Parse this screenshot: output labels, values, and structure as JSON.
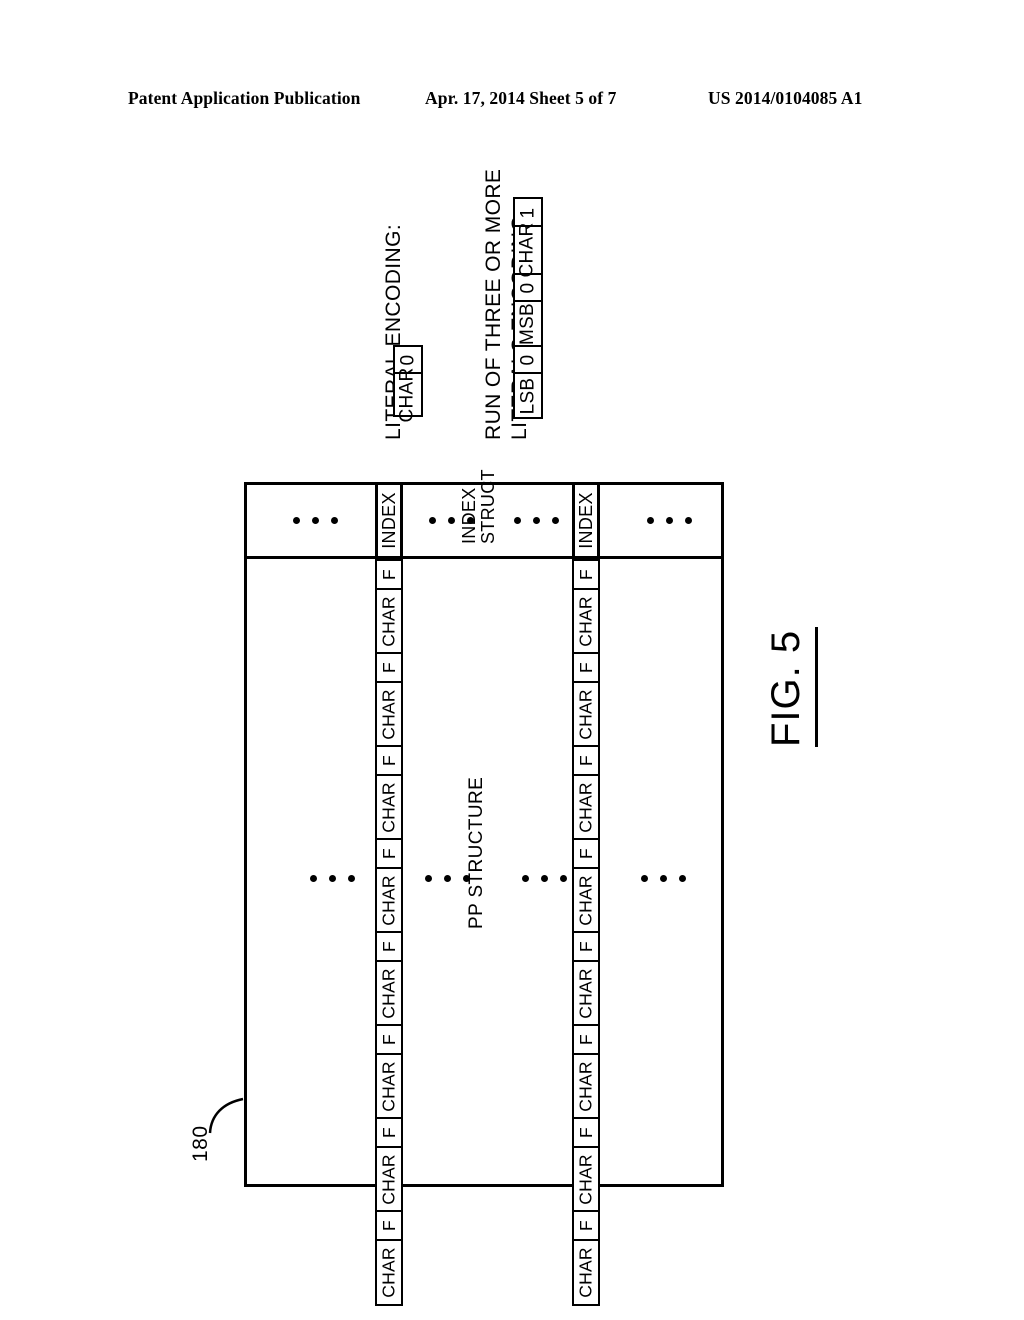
{
  "header": {
    "publication": "Patent Application Publication",
    "date_sheet": "Apr. 17, 2014  Sheet 5 of 7",
    "patent_number": "US 2014/0104085 A1"
  },
  "figure": {
    "label": "FIG. 5",
    "reference_numeral": "180",
    "center_label": "PP STRUCTURE",
    "index_struct_line1": "INDEX",
    "index_struct_line2": "STRUCT",
    "index_label": "INDEX",
    "field_f": "F",
    "field_char": "CHAR",
    "index_cells": [
      {
        "label": "INDEX"
      },
      {
        "label": "INDEX"
      }
    ],
    "strips": [
      {
        "name": "pp-strip-left",
        "cells": [
          {
            "type": "f",
            "label": "F"
          },
          {
            "type": "char",
            "label": "CHAR"
          },
          {
            "type": "f",
            "label": "F"
          },
          {
            "type": "char",
            "label": "CHAR"
          },
          {
            "type": "f",
            "label": "F"
          },
          {
            "type": "char",
            "label": "CHAR"
          },
          {
            "type": "f",
            "label": "F"
          },
          {
            "type": "char",
            "label": "CHAR"
          },
          {
            "type": "f",
            "label": "F"
          },
          {
            "type": "char",
            "label": "CHAR"
          },
          {
            "type": "f",
            "label": "F"
          },
          {
            "type": "char",
            "label": "CHAR"
          },
          {
            "type": "f",
            "label": "F"
          },
          {
            "type": "char",
            "label": "CHAR"
          },
          {
            "type": "f",
            "label": "F"
          },
          {
            "type": "char",
            "label": "CHAR"
          }
        ]
      },
      {
        "name": "pp-strip-right",
        "cells": [
          {
            "type": "f",
            "label": "F"
          },
          {
            "type": "char",
            "label": "CHAR"
          },
          {
            "type": "f",
            "label": "F"
          },
          {
            "type": "char",
            "label": "CHAR"
          },
          {
            "type": "f",
            "label": "F"
          },
          {
            "type": "char",
            "label": "CHAR"
          },
          {
            "type": "f",
            "label": "F"
          },
          {
            "type": "char",
            "label": "CHAR"
          },
          {
            "type": "f",
            "label": "F"
          },
          {
            "type": "char",
            "label": "CHAR"
          },
          {
            "type": "f",
            "label": "F"
          },
          {
            "type": "char",
            "label": "CHAR"
          },
          {
            "type": "f",
            "label": "F"
          },
          {
            "type": "char",
            "label": "CHAR"
          },
          {
            "type": "f",
            "label": "F"
          },
          {
            "type": "char",
            "label": "CHAR"
          }
        ]
      }
    ]
  },
  "legends": [
    {
      "name": "literal-encoding",
      "caption": "LITERAL ENCODING:",
      "fields": [
        {
          "label": "0",
          "size": "narrow"
        },
        {
          "label": "CHAR",
          "size": "wide"
        }
      ]
    },
    {
      "name": "run-encoding",
      "caption_line1": "RUN OF THREE OR MORE",
      "caption_line2": "LITERALS ENCODING:",
      "fields": [
        {
          "label": "1",
          "size": "narrow"
        },
        {
          "label": "CHAR",
          "size": "wide"
        },
        {
          "label": "0",
          "size": "narrow"
        },
        {
          "label": "MSB",
          "size": "wide"
        },
        {
          "label": "0",
          "size": "narrow"
        },
        {
          "label": "LSB",
          "size": "wide"
        }
      ]
    }
  ],
  "colors": {
    "ink": "#000000",
    "paper": "#ffffff"
  }
}
